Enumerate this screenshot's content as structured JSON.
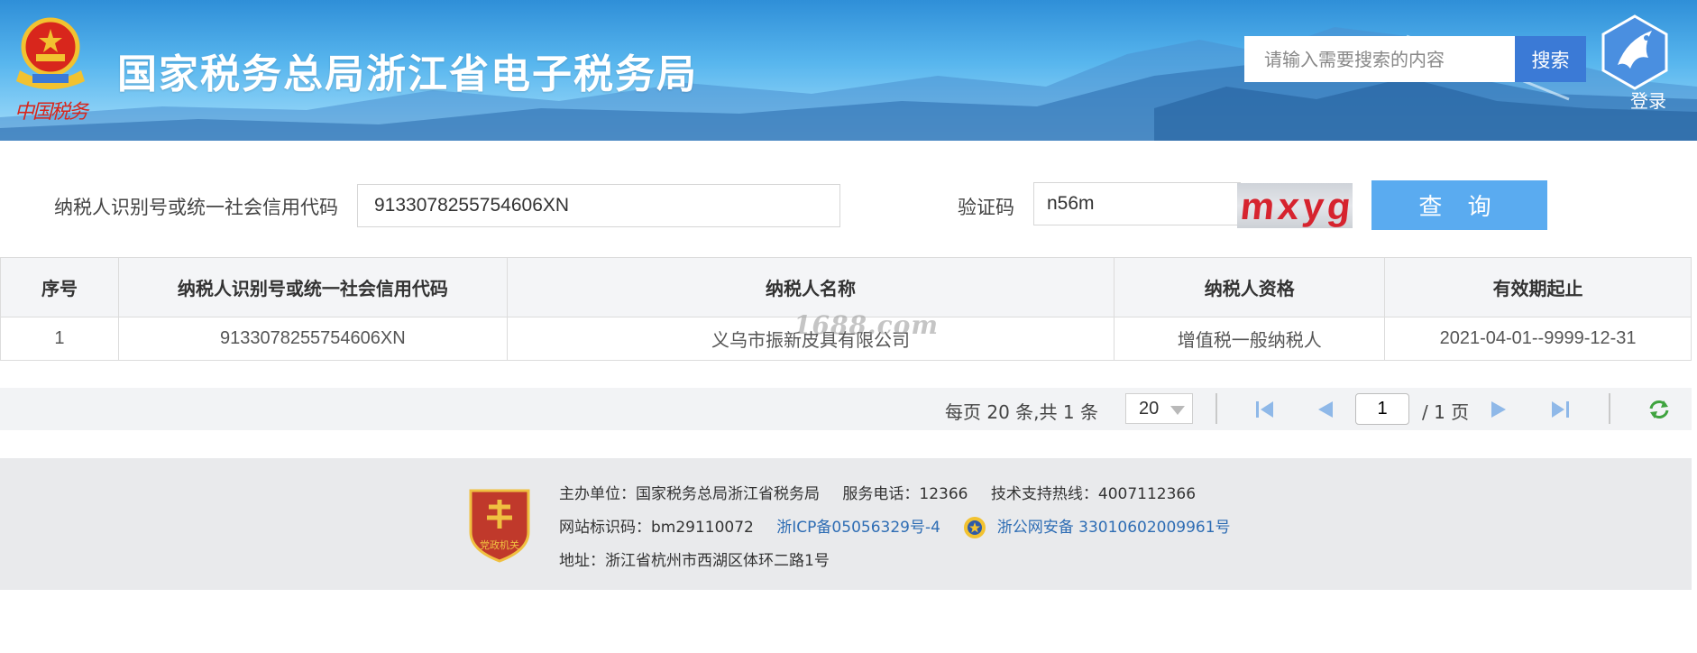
{
  "header": {
    "title": "国家税务总局浙江省电子税务局",
    "emblem_script": "中国税务",
    "search": {
      "placeholder": "请输入需要搜索的内容",
      "button_label": "搜索"
    },
    "login_label": "登录"
  },
  "query_form": {
    "tax_id_label": "纳税人识别号或统一社会信用代码",
    "tax_id_value": "9133078255754606XN",
    "captcha_label": "验证码",
    "captcha_value": "n56m",
    "captcha_image_text": "mxyg",
    "submit_label": "查 询"
  },
  "results_table": {
    "headers": [
      "序号",
      "纳税人识别号或统一社会信用代码",
      "纳税人名称",
      "纳税人资格",
      "有效期起止"
    ],
    "rows": [
      [
        "1",
        "9133078255754606XN",
        "义乌市振新皮具有限公司",
        "增值税一般纳税人",
        "2021-04-01--9999-12-31"
      ]
    ],
    "watermark": "1688.com"
  },
  "pagination": {
    "summary": "每页 20 条,共 1 条",
    "page_size": "20",
    "current_page": "1",
    "total_pages": "/ 1 页"
  },
  "footer": {
    "line1": {
      "sponsor": "主办单位：国家税务总局浙江省税务局",
      "service_phone": "服务电话：12366",
      "support_hotline": "技术支持热线：4007112366"
    },
    "line2": {
      "site_id": "网站标识码：bm29110072",
      "icp": "浙ICP备05056329号-4",
      "police": "浙公网安备 33010602009961号"
    },
    "line3": {
      "address": "地址：浙江省杭州市西湖区体环二路1号"
    },
    "badge_text": "党政机关"
  },
  "colors": {
    "header_blue": "#2f8fd8",
    "search_button": "#3b7ad6",
    "query_button": "#5aabf0",
    "link_blue": "#2e6db4",
    "captcha_red": "#d6232e",
    "footer_bg": "#e9eaec"
  }
}
